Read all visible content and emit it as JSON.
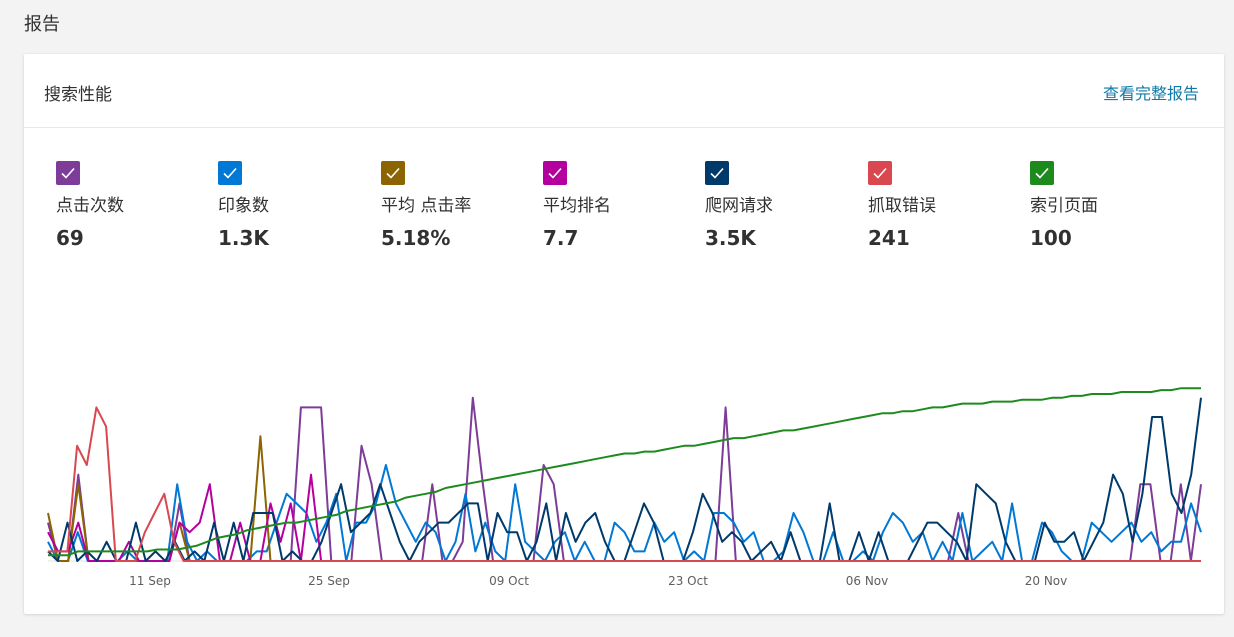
{
  "page_title": "报告",
  "card": {
    "title": "搜索性能",
    "link_label": "查看完整报告"
  },
  "metrics": [
    {
      "label": "点击次数",
      "value": "69",
      "color": "#7d3c98",
      "icon": "check-icon"
    },
    {
      "label": "印象数",
      "value": "1.3K",
      "color": "#0078d4",
      "icon": "check-icon"
    },
    {
      "label": "平均 点击率",
      "value": "5.18%",
      "color": "#8c6400",
      "icon": "check-icon"
    },
    {
      "label": "平均排名",
      "value": "7.7",
      "color": "#b4009e",
      "icon": "check-icon"
    },
    {
      "label": "爬网请求",
      "value": "3.5K",
      "color": "#003a6b",
      "icon": "check-icon"
    },
    {
      "label": "抓取错误",
      "value": "241",
      "color": "#d9474f",
      "icon": "check-icon"
    },
    {
      "label": "索引页面",
      "value": "100",
      "color": "#1e8a1e",
      "icon": "check-icon"
    }
  ],
  "chart_data": {
    "type": "line",
    "x_ticks": [
      "11 Sep",
      "25 Sep",
      "09 Oct",
      "23 Oct",
      "06 Nov",
      "20 Nov"
    ],
    "ylim": [
      0,
      100
    ],
    "grid": false,
    "series": [
      {
        "name": "点击次数",
        "color": "#7d3c98",
        "values": [
          20,
          0,
          0,
          45,
          0,
          0,
          0,
          0,
          0,
          0,
          0,
          0,
          0,
          30,
          0,
          0,
          0,
          0,
          0,
          0,
          0,
          0,
          0,
          0,
          0,
          80,
          80,
          80,
          0,
          0,
          0,
          60,
          40,
          0,
          0,
          0,
          0,
          0,
          40,
          0,
          0,
          10,
          85,
          40,
          0,
          0,
          0,
          0,
          0,
          50,
          40,
          0,
          0,
          0,
          0,
          0,
          0,
          0,
          0,
          0,
          0,
          0,
          0,
          0,
          0,
          0,
          0,
          80,
          0,
          0,
          0,
          0,
          0,
          0,
          0,
          0,
          0,
          0,
          0,
          0,
          0,
          0,
          0,
          0,
          0,
          0,
          0,
          0,
          0,
          0,
          25,
          0,
          0,
          0,
          0,
          0,
          0,
          0,
          0,
          0,
          0,
          0,
          0,
          0,
          0,
          0,
          0,
          0,
          40,
          40,
          0,
          0,
          40,
          0,
          40
        ]
      },
      {
        "name": "印象数",
        "color": "#0078d4",
        "values": [
          10,
          0,
          0,
          15,
          0,
          0,
          0,
          0,
          5,
          0,
          0,
          0,
          0,
          40,
          10,
          0,
          5,
          0,
          0,
          0,
          0,
          5,
          5,
          20,
          35,
          30,
          25,
          10,
          20,
          35,
          0,
          20,
          20,
          30,
          50,
          30,
          20,
          10,
          20,
          15,
          0,
          10,
          35,
          5,
          20,
          5,
          0,
          40,
          10,
          5,
          0,
          10,
          15,
          0,
          10,
          0,
          0,
          20,
          15,
          5,
          5,
          20,
          10,
          15,
          0,
          5,
          0,
          25,
          25,
          20,
          10,
          15,
          0,
          0,
          5,
          25,
          15,
          0,
          0,
          15,
          0,
          0,
          5,
          0,
          15,
          25,
          20,
          10,
          15,
          0,
          10,
          0,
          25,
          0,
          5,
          10,
          0,
          30,
          0,
          0,
          20,
          15,
          5,
          0,
          0,
          20,
          15,
          10,
          15,
          20,
          10,
          15,
          5,
          10,
          10,
          30,
          15
        ]
      },
      {
        "name": "平均 点击率",
        "color": "#8c6400",
        "values": [
          25,
          0,
          0,
          40,
          0,
          0,
          0,
          0,
          0,
          0,
          0,
          0,
          0,
          20,
          0,
          0,
          0,
          0,
          0,
          0,
          0,
          65,
          0,
          0,
          0,
          0,
          0,
          0,
          0,
          0,
          0,
          0,
          0,
          0,
          0,
          0,
          0,
          0,
          0,
          0,
          0,
          0,
          0,
          0,
          0,
          0,
          0,
          0,
          0,
          0,
          0,
          0,
          0,
          0,
          0,
          0,
          0,
          0,
          0,
          0,
          0,
          0,
          0,
          0,
          0,
          0,
          0,
          0,
          0,
          0,
          0,
          0,
          0,
          0,
          0,
          0,
          0,
          0,
          0,
          0,
          0,
          0,
          0,
          0,
          0,
          0,
          0,
          0,
          0,
          0,
          0,
          0,
          0,
          0,
          0,
          0,
          0,
          0,
          0,
          0,
          0,
          0,
          0,
          0,
          0,
          0,
          0,
          0,
          0,
          0,
          0,
          0,
          0,
          0,
          0
        ]
      },
      {
        "name": "平均排名",
        "color": "#b4009e",
        "values": [
          15,
          5,
          5,
          20,
          0,
          0,
          0,
          0,
          10,
          0,
          0,
          0,
          0,
          20,
          15,
          20,
          40,
          0,
          0,
          20,
          0,
          0,
          30,
          10,
          30,
          0,
          45,
          0,
          0,
          0,
          0,
          0,
          0,
          0,
          0,
          0,
          0,
          0,
          0,
          0,
          0,
          0,
          0,
          0,
          0,
          0,
          0,
          0,
          0,
          0,
          0,
          0,
          0,
          0,
          0,
          0,
          0,
          0,
          0,
          0,
          0,
          0,
          0,
          0,
          0,
          0,
          0,
          0,
          0,
          0,
          0,
          0,
          0,
          0,
          0,
          0,
          0,
          0,
          0,
          0,
          0,
          0,
          0,
          0,
          0,
          0,
          0,
          0,
          0,
          0,
          0,
          0,
          0,
          0,
          0,
          0,
          0,
          0,
          0,
          0,
          0,
          0,
          0,
          0,
          0,
          0,
          0,
          0,
          0,
          0,
          0,
          0,
          0,
          0,
          0
        ]
      },
      {
        "name": "爬网请求",
        "color": "#003a6b",
        "values": [
          5,
          0,
          20,
          0,
          5,
          0,
          10,
          0,
          0,
          20,
          0,
          5,
          0,
          10,
          0,
          5,
          0,
          20,
          0,
          20,
          0,
          25,
          25,
          25,
          0,
          5,
          0,
          0,
          10,
          25,
          40,
          15,
          20,
          25,
          40,
          25,
          10,
          0,
          10,
          15,
          20,
          20,
          25,
          30,
          30,
          0,
          25,
          15,
          15,
          0,
          10,
          30,
          0,
          25,
          10,
          20,
          25,
          10,
          0,
          0,
          15,
          30,
          20,
          0,
          0,
          0,
          15,
          35,
          25,
          10,
          15,
          10,
          0,
          5,
          10,
          0,
          15,
          0,
          0,
          0,
          30,
          0,
          0,
          15,
          0,
          15,
          0,
          0,
          0,
          10,
          20,
          20,
          15,
          10,
          0,
          40,
          35,
          30,
          10,
          0,
          0,
          0,
          20,
          10,
          10,
          15,
          0,
          10,
          20,
          45,
          35,
          10,
          35,
          75,
          75,
          35,
          25,
          45,
          85
        ]
      },
      {
        "name": "抓取错误",
        "color": "#d9474f",
        "values": [
          5,
          5,
          5,
          60,
          50,
          80,
          70,
          0,
          0,
          0,
          15,
          25,
          35,
          10,
          0,
          0,
          0,
          0,
          0,
          0,
          0,
          0,
          0,
          0,
          0,
          0,
          0,
          0,
          0,
          0,
          0,
          0,
          0,
          0,
          0,
          0,
          0,
          0,
          0,
          0,
          0,
          0,
          0,
          0,
          0,
          0,
          0,
          0,
          0,
          0,
          0,
          0,
          0,
          0,
          0,
          0,
          0,
          0,
          0,
          0,
          0,
          0,
          0,
          0,
          0,
          0,
          0,
          0,
          0,
          0,
          0,
          0,
          0,
          0,
          0,
          0,
          0,
          0,
          0,
          0,
          0,
          0,
          0,
          0,
          0,
          0,
          0,
          0,
          0,
          0,
          0,
          0,
          0,
          0,
          0,
          0,
          0,
          0,
          0,
          0,
          0,
          0,
          0,
          0,
          0,
          0,
          0,
          0,
          0,
          0,
          0,
          0,
          0,
          0,
          0,
          0,
          0,
          0,
          0,
          0
        ]
      },
      {
        "name": "索引页面",
        "color": "#1e8a1e",
        "values": [
          3,
          3,
          3,
          5,
          5,
          5,
          5,
          5,
          5,
          5,
          5,
          6,
          6,
          6,
          7,
          8,
          10,
          12,
          13,
          14,
          16,
          17,
          18,
          19,
          20,
          20,
          21,
          22,
          23,
          24,
          26,
          27,
          28,
          29,
          30,
          31,
          33,
          34,
          35,
          36,
          38,
          39,
          40,
          41,
          42,
          43,
          44,
          45,
          46,
          47,
          48,
          49,
          50,
          51,
          52,
          53,
          54,
          55,
          56,
          56,
          57,
          57,
          58,
          59,
          60,
          60,
          61,
          62,
          63,
          64,
          64,
          65,
          66,
          67,
          68,
          68,
          69,
          70,
          71,
          72,
          73,
          74,
          75,
          76,
          77,
          77,
          78,
          78,
          79,
          80,
          80,
          81,
          82,
          82,
          82,
          83,
          83,
          83,
          84,
          84,
          84,
          85,
          85,
          86,
          86,
          87,
          87,
          87,
          88,
          88,
          88,
          88,
          89,
          89,
          90,
          90,
          90
        ]
      }
    ]
  }
}
